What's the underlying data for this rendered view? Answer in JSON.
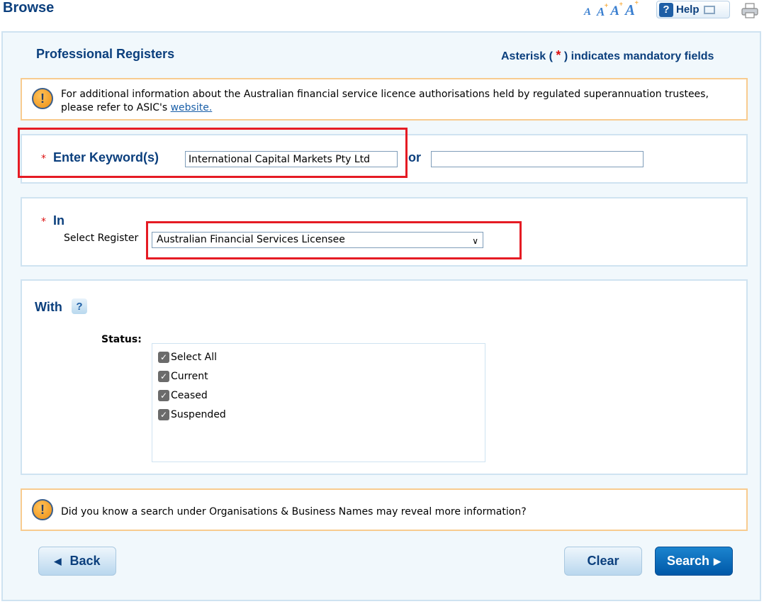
{
  "header": {
    "title": "Browse",
    "font_size_controls": [
      "A",
      "A",
      "A",
      "A"
    ],
    "help_label": "Help",
    "help_icon": "question-mark-icon",
    "popout_icon": "popout-window-icon",
    "print_icon": "printer-icon"
  },
  "form": {
    "heading": "Professional Registers",
    "mandatory_note": {
      "prefix": "Asterisk (",
      "star": "*",
      "suffix": ") indicates mandatory fields"
    },
    "top_notice": {
      "icon": "warning-icon",
      "text": "For additional information about the Australian financial service licence authorisations held by regulated superannuation trustees, please refer to ASIC's ",
      "link_text": "website."
    },
    "keyword": {
      "required_star": "*",
      "label": "Enter Keyword(s)",
      "value": "International Capital Markets Pty Ltd",
      "or_label": "or",
      "second_value": ""
    },
    "in": {
      "required_star": "*",
      "label": "In",
      "select_label": "Select Register",
      "selected_value": "Australian Financial Services Licensee"
    },
    "with": {
      "label": "With",
      "help_icon": "help-bubble-icon",
      "status_label": "Status:",
      "statuses": [
        {
          "label": "Select All",
          "checked": true
        },
        {
          "label": "Current",
          "checked": true
        },
        {
          "label": "Ceased",
          "checked": true
        },
        {
          "label": "Suspended",
          "checked": true
        }
      ]
    },
    "bottom_notice": {
      "icon": "warning-icon",
      "text": "Did you know a search under Organisations & Business Names may reveal more information?"
    },
    "buttons": {
      "back": "Back",
      "clear": "Clear",
      "search": "Search"
    }
  },
  "colors": {
    "brand_navy": "#0b3f7d",
    "highlight_red": "#e51b24",
    "notice_border": "#f8cb8f",
    "primary_button": "#0058a8"
  }
}
